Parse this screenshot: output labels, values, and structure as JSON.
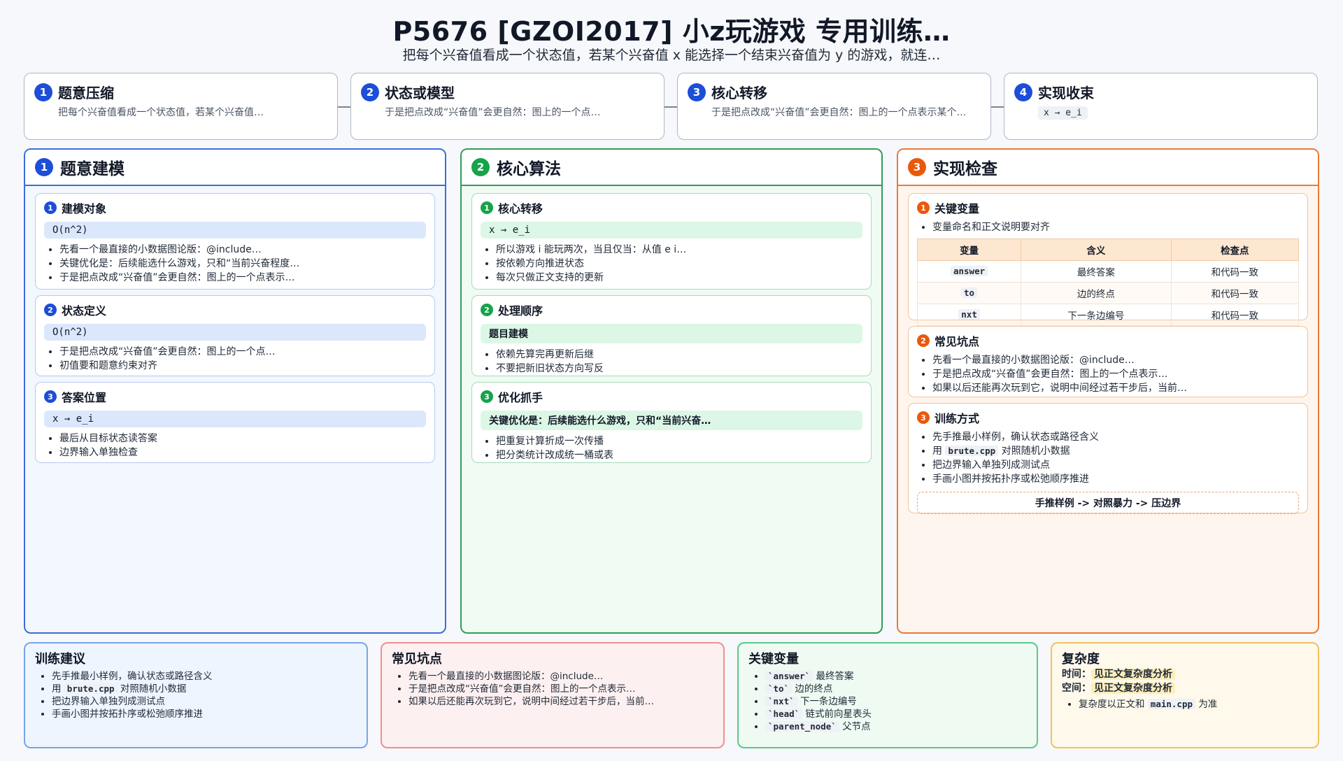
{
  "header": {
    "title": "P5676 [GZOI2017] 小z玩游戏 专用训练…",
    "subtitle": "把每个兴奋值看成一个状态值，若某个兴奋值 x 能选择一个结束兴奋值为 y 的游戏，就连…"
  },
  "steps": [
    {
      "num": "1",
      "name": "题意压缩",
      "desc": "把每个兴奋值看成一个状态值，若某个兴奋值…"
    },
    {
      "num": "2",
      "name": "状态或模型",
      "desc": "于是把点改成“兴奋值”会更自然：图上的一个点…"
    },
    {
      "num": "3",
      "name": "核心转移",
      "desc": "于是把点改成“兴奋值”会更自然：图上的一个点表示某个…"
    },
    {
      "num": "4",
      "name": "实现收束",
      "code": "x → e_i"
    }
  ],
  "col1": {
    "num": "1",
    "title": "题意建模",
    "cards": [
      {
        "num": "1",
        "title": "建模对象",
        "bar": "O(n^2)",
        "items": [
          "先看一个最直接的小数据图论版：@include…",
          "关键优化是：后续能选什么游戏，只和“当前兴奋程度…",
          "于是把点改成“兴奋值”会更自然：图上的一个点表示…"
        ]
      },
      {
        "num": "2",
        "title": "状态定义",
        "bar": "O(n^2)",
        "items": [
          "于是把点改成“兴奋值”会更自然：图上的一个点…",
          "初值要和题意约束对齐"
        ]
      },
      {
        "num": "3",
        "title": "答案位置",
        "bar": "x → e_i",
        "items": [
          "最后从目标状态读答案",
          "边界输入单独检查"
        ]
      }
    ]
  },
  "col2": {
    "num": "2",
    "title": "核心算法",
    "cards": [
      {
        "num": "1",
        "title": "核心转移",
        "bar": "x → e_i",
        "items": [
          "所以游戏 i 能玩两次，当且仅当：从值 e i…",
          "按依赖方向推进状态",
          "每次只做正文支持的更新"
        ]
      },
      {
        "num": "2",
        "title": "处理顺序",
        "bar": "题目建模",
        "items": [
          "依赖先算完再更新后继",
          "不要把新旧状态方向写反"
        ]
      },
      {
        "num": "3",
        "title": "优化抓手",
        "bar": "关键优化是：后续能选什么游戏，只和“当前兴奋…",
        "items": [
          "把重复计算折成一次传播",
          "把分类统计改成统一桶或表"
        ]
      }
    ]
  },
  "col3": {
    "num": "3",
    "title": "实现检查",
    "vars": {
      "num": "1",
      "title": "关键变量",
      "note": "变量命名和正文说明要对齐",
      "headers": [
        "变量",
        "含义",
        "检查点"
      ],
      "rows": [
        [
          "answer",
          "最终答案",
          "和代码一致"
        ],
        [
          "to",
          "边的终点",
          "和代码一致"
        ],
        [
          "nxt",
          "下一条边编号",
          "和代码一致"
        ]
      ]
    },
    "pitfalls": {
      "num": "2",
      "title": "常见坑点",
      "items": [
        "先看一个最直接的小数据图论版：@include…",
        "于是把点改成“兴奋值”会更自然：图上的一个点表示…",
        "如果以后还能再次玩到它，说明中间经过若干步后，当前…"
      ]
    },
    "training": {
      "num": "3",
      "title": "训练方式",
      "item1": "先手推最小样例，确认状态或路径含义",
      "item2_pre": "用",
      "item2_code": "brute.cpp",
      "item2_post": "对照随机小数据",
      "item3": "把边界输入单独列成测试点",
      "item4": "手画小图并按拓扑序或松弛顺序推进",
      "flow": "手推样例 -> 对照暴力 -> 压边界"
    }
  },
  "bottom": {
    "advice": {
      "title": "训练建议",
      "item1": "先手推最小样例，确认状态或路径含义",
      "item2_pre": "用",
      "item2_code": "brute.cpp",
      "item2_post": "对照随机小数据",
      "item3": "把边界输入单独列成测试点",
      "item4": "手画小图并按拓扑序或松弛顺序推进"
    },
    "pitfalls": {
      "title": "常见坑点",
      "items": [
        "先看一个最直接的小数据图论版：@include…",
        "于是把点改成“兴奋值”会更自然：图上的一个点表示…",
        "如果以后还能再次玩到它，说明中间经过若干步后，当前…"
      ]
    },
    "vars": {
      "title": "关键变量",
      "items": [
        {
          "code": "`answer`",
          "text": "最终答案"
        },
        {
          "code": "`to`",
          "text": "边的终点"
        },
        {
          "code": "`nxt`",
          "text": "下一条边编号"
        },
        {
          "code": "`head`",
          "text": "链式前向星表头"
        },
        {
          "code": "`parent_node`",
          "text": "父节点"
        }
      ]
    },
    "complexity": {
      "title": "复杂度",
      "time_label": "时间：",
      "time_value": "见正文复杂度分析",
      "space_label": "空间：",
      "space_value": "见正文复杂度分析",
      "note_pre": "复杂度以正文和",
      "note_code": "main.cpp",
      "note_post": "为准"
    }
  }
}
